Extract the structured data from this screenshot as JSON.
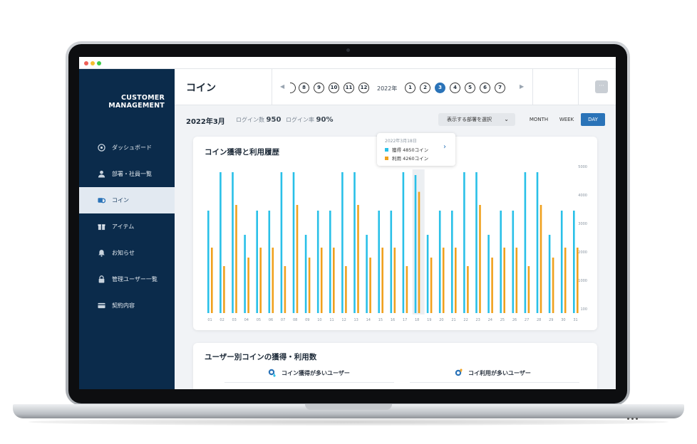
{
  "app": {
    "brand_line1": "CUSTOMER",
    "brand_line2": "MANAGEMENT"
  },
  "sidebar": {
    "items": [
      {
        "label": "ダッシュボード",
        "icon": "dashboard-icon",
        "active": false
      },
      {
        "label": "部署・社員一覧",
        "icon": "person-icon",
        "active": false
      },
      {
        "label": "コイン",
        "icon": "coin-icon",
        "active": true
      },
      {
        "label": "アイテム",
        "icon": "gift-icon",
        "active": false
      },
      {
        "label": "お知らせ",
        "icon": "bell-icon",
        "active": false
      },
      {
        "label": "管理ユーザー一覧",
        "icon": "lock-icon",
        "active": false
      },
      {
        "label": "契約内容",
        "icon": "card-icon",
        "active": false
      }
    ]
  },
  "header": {
    "title": "コイン",
    "prev_days": [
      "8",
      "9",
      "10",
      "11",
      "12"
    ],
    "year_label": "2022年",
    "next_days": [
      "1",
      "2",
      "3",
      "4",
      "5",
      "6",
      "7"
    ],
    "selected_day": "3",
    "more_label": "···"
  },
  "subbar": {
    "month": "2022年3月",
    "login_count_label": "ログイン数",
    "login_count_value": "950",
    "login_rate_label": "ログイン率",
    "login_rate_value": "90%",
    "dept_select_label": "表示する部署を選択",
    "segments": [
      "MONTH",
      "WEEK",
      "DAY"
    ],
    "active_segment": "DAY"
  },
  "chart_card": {
    "title": "コイン獲得と利用履歴"
  },
  "tooltip": {
    "date": "2022年3月18日",
    "earned_text": "獲得 4850コイン",
    "used_text": "利用 4260コイン"
  },
  "chart_data": {
    "type": "bar",
    "title": "コイン獲得と利用履歴",
    "categories": [
      "01",
      "02",
      "03",
      "04",
      "05",
      "06",
      "07",
      "08",
      "09",
      "10",
      "11",
      "12",
      "13",
      "14",
      "15",
      "16",
      "17",
      "18",
      "19",
      "20",
      "21",
      "22",
      "23",
      "24",
      "25",
      "26",
      "27",
      "28",
      "29",
      "30",
      "31"
    ],
    "y_ticks": [
      "100",
      "1000",
      "2000",
      "3000",
      "4000",
      "5000"
    ],
    "ylim": [
      0,
      5000
    ],
    "highlighted_category": "18",
    "series": [
      {
        "name": "獲得",
        "color": "#29c0e8",
        "values": [
          3600,
          4950,
          4950,
          2750,
          3600,
          3600,
          4950,
          4950,
          2750,
          3600,
          3600,
          4950,
          4950,
          2750,
          3600,
          3600,
          4950,
          4850,
          2750,
          3600,
          3600,
          4950,
          4950,
          2750,
          3600,
          3600,
          4950,
          4950,
          2750,
          3600,
          3600
        ]
      },
      {
        "name": "利用",
        "color": "#f0a11e",
        "values": [
          2300,
          1650,
          3800,
          1950,
          2300,
          2300,
          1650,
          3800,
          1950,
          2300,
          2300,
          1650,
          3800,
          1950,
          2300,
          2300,
          1650,
          4260,
          1950,
          2300,
          2300,
          1650,
          3800,
          1950,
          2300,
          2300,
          1650,
          3800,
          1950,
          2300,
          2300
        ]
      }
    ],
    "grid": false,
    "legend": "tooltip"
  },
  "ranking_card": {
    "title": "ユーザー別コインの獲得・利用数",
    "left_heading": "コイン獲得が多いユーザー",
    "right_heading": "コイ利用が多いユーザー"
  },
  "colors": {
    "sidebar_bg": "#0b2b4b",
    "accent": "#2a73b8",
    "earned": "#29c0e8",
    "used": "#f0a11e"
  }
}
